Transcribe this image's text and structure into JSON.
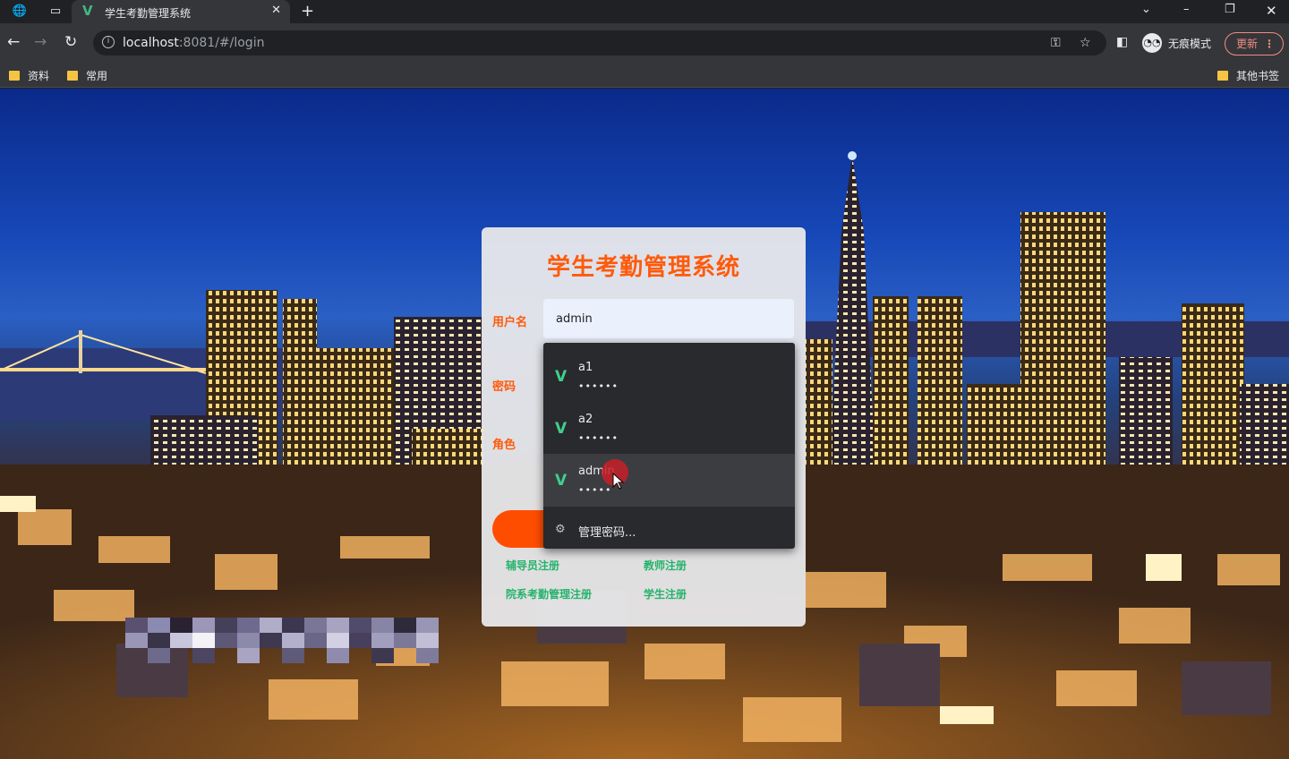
{
  "browser": {
    "tab_title": "学生考勤管理系统",
    "url_host": "localhost",
    "url_rest": ":8081/#/login",
    "incognito_label": "无痕模式",
    "update_label": "更新",
    "bookmarks": [
      "资料",
      "常用"
    ],
    "other_bookmarks": "其他书签"
  },
  "login": {
    "title": "学生考勤管理系统",
    "username_label": "用户名",
    "username_value": "admin",
    "password_label": "密码",
    "role_label": "角色",
    "links": {
      "counselor_register": "辅导员注册",
      "teacher_register": "教师注册",
      "department_register": "院系考勤管理注册",
      "student_register": "学生注册"
    }
  },
  "autofill": {
    "items": [
      {
        "username": "a1",
        "password_mask": "••••••"
      },
      {
        "username": "a2",
        "password_mask": "••••••"
      },
      {
        "username": "admin",
        "password_mask": "•••••"
      }
    ],
    "manage_label": "管理密码..."
  },
  "colors": {
    "accent": "#ff5a0a",
    "link": "#24b36b",
    "vue_green": "#41b883"
  }
}
